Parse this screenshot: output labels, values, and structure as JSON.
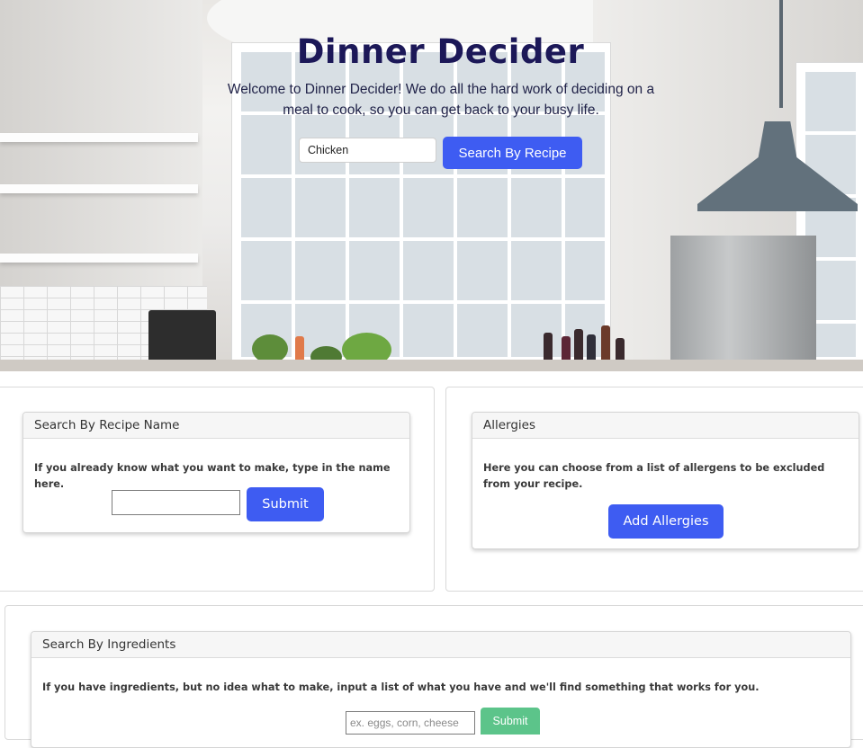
{
  "hero": {
    "title": "Dinner Decider",
    "description": "Welcome to Dinner Decider! We do all the hard work of deciding on a meal to cook, so you can get back to your busy life.",
    "search_value": "Chicken",
    "search_button": "Search By Recipe"
  },
  "recipe_card": {
    "header": "Search By Recipe Name",
    "text": "If you already know what you want to make, type in the name here.",
    "input_value": "",
    "submit_label": "Submit"
  },
  "allergies_card": {
    "header": "Allergies",
    "text": "Here you can choose from a list of allergens to be excluded from your recipe.",
    "button_label": "Add Allergies"
  },
  "ingredients_card": {
    "header": "Search By Ingredients",
    "text": "If you have ingredients, but no idea what to make, input a list of what you have and we'll find something that works for you.",
    "input_placeholder": "ex. eggs, corn, cheese",
    "submit_label": "Submit"
  },
  "colors": {
    "primary": "#3e5cf2",
    "success": "#5cc48a",
    "title": "#1c1858"
  }
}
